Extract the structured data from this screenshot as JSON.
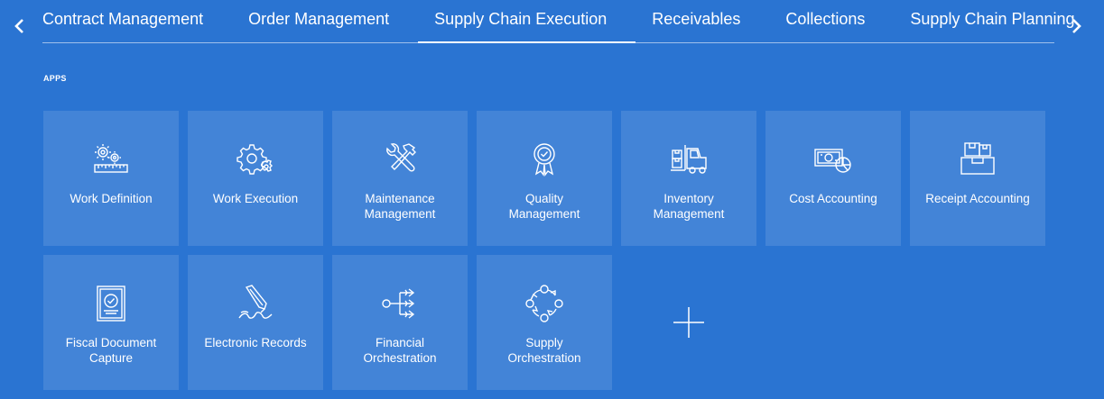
{
  "tabs": [
    {
      "label": "Contract Management",
      "active": false
    },
    {
      "label": "Order Management",
      "active": false
    },
    {
      "label": "Supply Chain Execution",
      "active": true
    },
    {
      "label": "Receivables",
      "active": false
    },
    {
      "label": "Collections",
      "active": false
    },
    {
      "label": "Supply Chain Planning",
      "active": false
    }
  ],
  "section_label": "APPS",
  "apps": [
    {
      "label": "Work Definition",
      "icon": "gears-ruler-icon"
    },
    {
      "label": "Work Execution",
      "icon": "gears-icon"
    },
    {
      "label": "Maintenance Management",
      "icon": "tools-icon"
    },
    {
      "label": "Quality Management",
      "icon": "ribbon-award-icon"
    },
    {
      "label": "Inventory Management",
      "icon": "forklift-icon"
    },
    {
      "label": "Cost Accounting",
      "icon": "money-chart-icon"
    },
    {
      "label": "Receipt Accounting",
      "icon": "boxes-icon"
    },
    {
      "label": "Fiscal Document Capture",
      "icon": "document-check-icon"
    },
    {
      "label": "Electronic Records",
      "icon": "pen-signature-icon"
    },
    {
      "label": "Financial Orchestration",
      "icon": "flow-arrows-icon"
    },
    {
      "label": "Supply Orchestration",
      "icon": "cycle-icon"
    }
  ],
  "add_tile_icon": "plus-icon",
  "colors": {
    "background": "#2A74D2",
    "tile": "rgba(255,255,255,0.12)"
  }
}
